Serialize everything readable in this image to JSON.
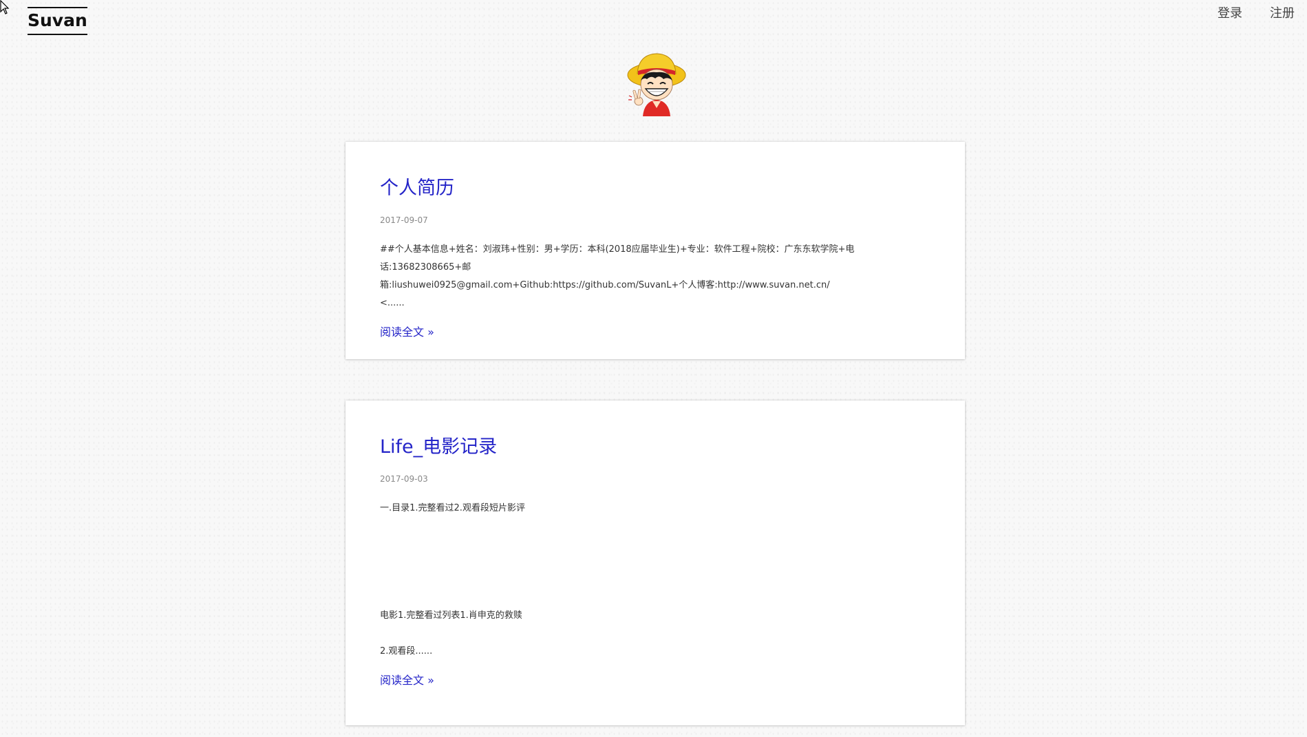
{
  "header": {
    "logo": "Suvan",
    "nav": [
      {
        "label": "登录"
      },
      {
        "label": "注册"
      }
    ]
  },
  "avatar": {
    "icon": "cartoon-avatar-icon",
    "colors": {
      "hat": "#f2c21a",
      "hat_band": "#d6262a",
      "shirt": "#e02a26",
      "skin": "#ffe1c2",
      "hair": "#1a1a1a"
    }
  },
  "posts": [
    {
      "title": "个人简历",
      "date": "2017-09-07",
      "excerpt": [
        "##个人基本信息+姓名：刘淑玮+性别：男+学历：本科(2018应届毕业生)+专业：软件工程+院校：广东东软学院+电话:13682308665+邮",
        "箱:liushuwei0925@gmail.com+Github:https://github.com/SuvanL+个人博客:http://www.suvan.net.cn/",
        "<......"
      ],
      "read_more": "阅读全文 »"
    },
    {
      "title": "Life_电影记录",
      "date": "2017-09-03",
      "excerpt": [
        "一.目录1.完整看过2.观看段短片影评",
        "电影1.完整看过列表1.肖申克的救赎",
        "2.观看段......"
      ],
      "read_more": "阅读全文 »"
    }
  ],
  "colors": {
    "link": "#2424c8",
    "background": "#f8f8f8",
    "card": "#ffffff"
  }
}
